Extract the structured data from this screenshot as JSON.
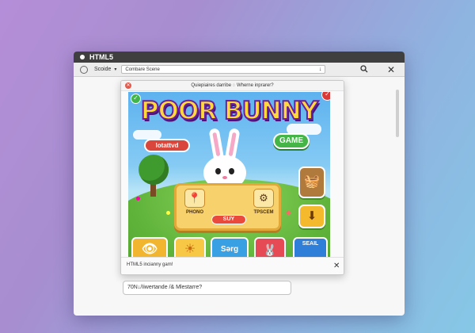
{
  "window": {
    "title": "HTML5",
    "toolbar": {
      "source_label": "Scoide",
      "address_value": "Combare Scene",
      "caret": "▾",
      "go_glyph": "↓",
      "search_icon": "search-icon",
      "close_glyph": "✕"
    }
  },
  "panel": {
    "header": "Quiepiaires darribe ◌ Wherne inprarer?",
    "close_glyph": "✕",
    "footer_text": "HTML5 incianny gam!",
    "footer_close": "✕"
  },
  "game": {
    "title": "POOR BUNNY",
    "name_pill": "lotattvd",
    "game_pill": "GAME",
    "corner_left_glyph": "✓",
    "corner_right_glyph": "✓",
    "board": {
      "left_label": "PHONO",
      "right_label": "TPSCEM",
      "button": "SUY",
      "left_icon": "📍",
      "right_icon": "⚙"
    },
    "side": {
      "basket_icon": "🧺",
      "download_glyph": "⬇"
    },
    "bottom": {
      "eye_icon": "👁",
      "sun_icon": "☀",
      "middle_label": "Sǝrg",
      "face_icon": "🐰",
      "right_label": "SEAIL"
    },
    "colors": {
      "title_fill": "#ffd93a",
      "title_outline": "#6a1f9e",
      "sky": "#5db2ef",
      "grass": "#5fb33a",
      "bunny_outfit": "#3b63c9"
    }
  },
  "status_field": "70N↓/Iiwertande /& Mlestarre?"
}
